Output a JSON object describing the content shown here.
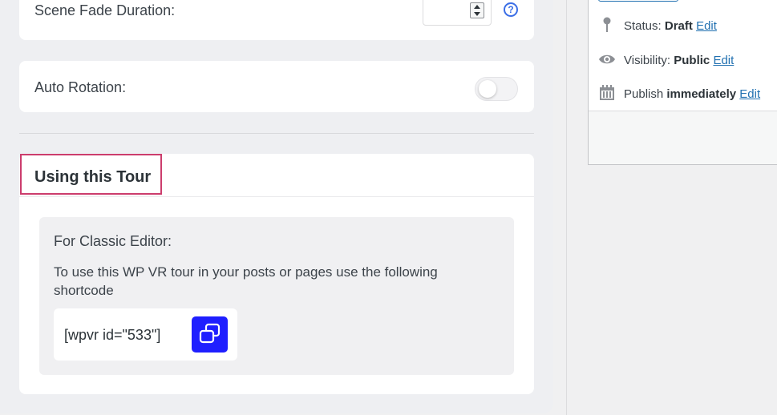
{
  "settings": {
    "scene_fade_label": "Scene Fade Duration:",
    "scene_fade_value": "",
    "help_glyph": "?",
    "auto_rotation_label": "Auto Rotation:",
    "auto_rotation_on": false
  },
  "usage": {
    "title": "Using this Tour",
    "classic_title": "For Classic Editor:",
    "classic_desc": "To use this WP VR tour in your posts or pages use the following shortcode",
    "shortcode": "[wpvr id=\"533\"]",
    "copy_icon": "copy-icon"
  },
  "publish": {
    "status_label": "Status:",
    "status_value": "Draft",
    "visibility_label": "Visibility:",
    "visibility_value": "Public",
    "publish_label": "Publish",
    "publish_value": "immediately",
    "edit_label": "Edit"
  },
  "colors": {
    "accent_blue": "#1f1fff",
    "link_blue": "#2271b1",
    "highlight_border": "#cc3d6d"
  }
}
